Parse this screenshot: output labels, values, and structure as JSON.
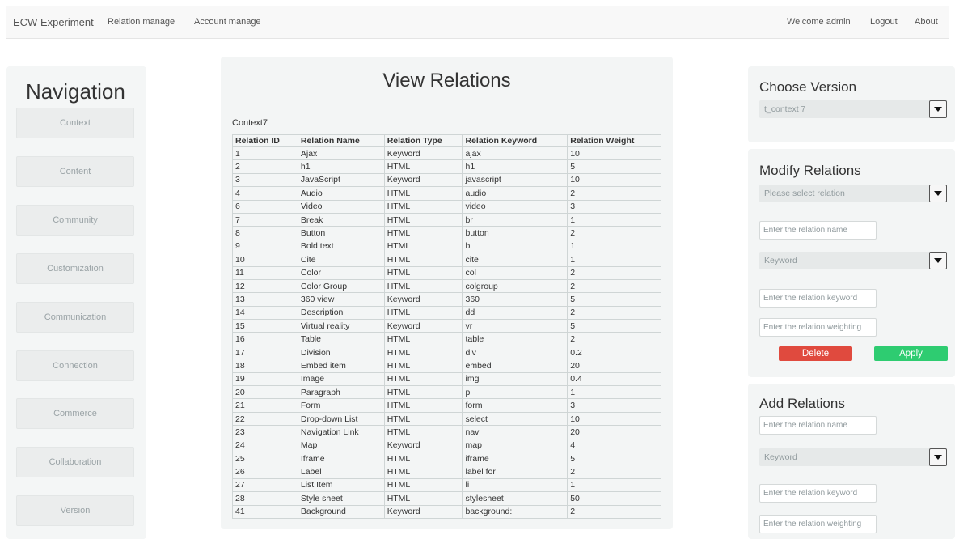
{
  "topbar": {
    "brand": "ECW Experiment",
    "links": [
      "Relation manage",
      "Account manage"
    ],
    "welcome": "Welcome admin",
    "logout": "Logout",
    "about": "About"
  },
  "navigation": {
    "title": "Navigation",
    "items": [
      "Context",
      "Content",
      "Community",
      "Customization",
      "Communication",
      "Connection",
      "Commerce",
      "Collaboration",
      "Version"
    ]
  },
  "main": {
    "title": "View Relations",
    "context_label": "Context7",
    "columns": [
      "Relation ID",
      "Relation Name",
      "Relation Type",
      "Relation Keyword",
      "Relation Weight"
    ],
    "rows": [
      [
        "1",
        "Ajax",
        "Keyword",
        "ajax",
        "10"
      ],
      [
        "2",
        "h1",
        "HTML",
        "h1",
        "5"
      ],
      [
        "3",
        "JavaScript",
        "Keyword",
        "javascript",
        "10"
      ],
      [
        "4",
        "Audio",
        "HTML",
        "audio",
        "2"
      ],
      [
        "6",
        "Video",
        "HTML",
        "video",
        "3"
      ],
      [
        "7",
        "Break",
        "HTML",
        "br",
        "1"
      ],
      [
        "8",
        "Button",
        "HTML",
        "button",
        "2"
      ],
      [
        "9",
        "Bold text",
        "HTML",
        "b",
        "1"
      ],
      [
        "10",
        "Cite",
        "HTML",
        "cite",
        "1"
      ],
      [
        "11",
        "Color",
        "HTML",
        "col",
        "2"
      ],
      [
        "12",
        "Color Group",
        "HTML",
        "colgroup",
        "2"
      ],
      [
        "13",
        "360 view",
        "Keyword",
        "360",
        "5"
      ],
      [
        "14",
        "Description",
        "HTML",
        "dd",
        "2"
      ],
      [
        "15",
        "Virtual reality",
        "Keyword",
        "vr",
        "5"
      ],
      [
        "16",
        "Table",
        "HTML",
        "table",
        "2"
      ],
      [
        "17",
        "Division",
        "HTML",
        "div",
        "0.2"
      ],
      [
        "18",
        "Embed item",
        "HTML",
        "embed",
        "20"
      ],
      [
        "19",
        "Image",
        "HTML",
        "img",
        "0.4"
      ],
      [
        "20",
        "Paragraph",
        "HTML",
        "p",
        "1"
      ],
      [
        "21",
        "Form",
        "HTML",
        "form",
        "3"
      ],
      [
        "22",
        "Drop-down List",
        "HTML",
        "select",
        "10"
      ],
      [
        "23",
        "Navigation Link",
        "HTML",
        "nav",
        "20"
      ],
      [
        "24",
        "Map",
        "Keyword",
        "map",
        "4"
      ],
      [
        "25",
        "Iframe",
        "HTML",
        "iframe",
        "5"
      ],
      [
        "26",
        "Label",
        "HTML",
        "label for",
        "2"
      ],
      [
        "27",
        "List Item",
        "HTML",
        "li",
        "1"
      ],
      [
        "28",
        "Style sheet",
        "HTML",
        "stylesheet",
        "50"
      ],
      [
        "41",
        "Background",
        "Keyword",
        "background:",
        "2"
      ]
    ]
  },
  "choose_version": {
    "title": "Choose Version",
    "selected": "t_context 7"
  },
  "modify_relations": {
    "title": "Modify Relations",
    "relation_select": "Please select relation",
    "name_placeholder": "Enter the relation name",
    "type_select": "Keyword",
    "keyword_placeholder": "Enter the relation keyword",
    "weighting_placeholder": "Enter the relation weighting",
    "delete_label": "Delete",
    "apply_label": "Apply"
  },
  "add_relations": {
    "title": "Add Relations",
    "name_placeholder": "Enter the relation name",
    "type_select": "Keyword",
    "keyword_placeholder": "Enter the relation keyword",
    "weighting_placeholder": "Enter the relation weighting"
  },
  "colors": {
    "delete": "#e04a3e",
    "apply": "#2ecc71",
    "panel": "#f3f5f5"
  },
  "icons": [
    "chevron-down-icon"
  ]
}
